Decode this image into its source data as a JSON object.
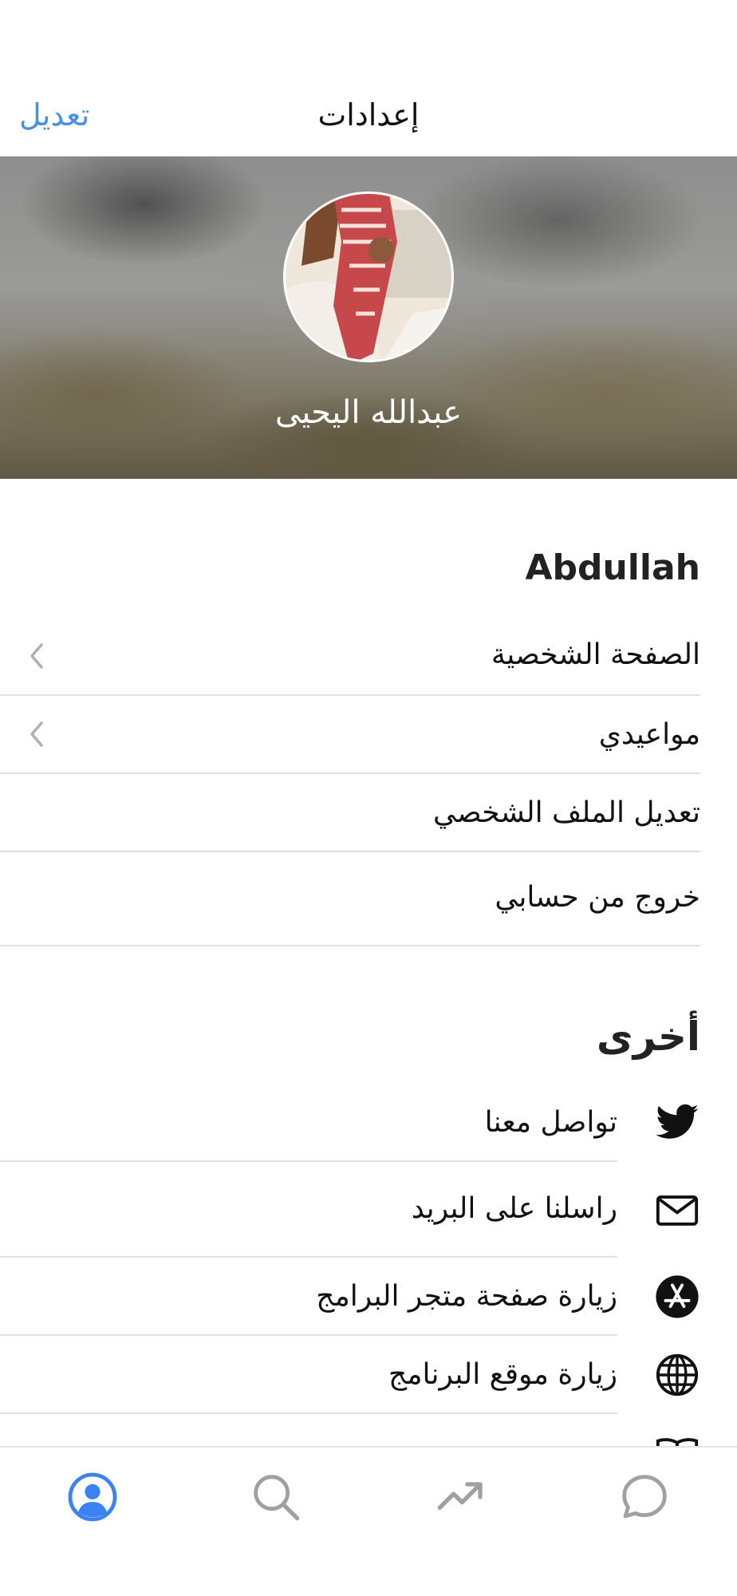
{
  "nav": {
    "title": "إعدادات",
    "edit_label": "تعديل"
  },
  "profile": {
    "name": "عبدالله اليحيى"
  },
  "account_section": {
    "title": "Abdullah",
    "items": [
      {
        "label": "الصفحة الشخصية",
        "icon": "chevron-left-icon"
      },
      {
        "label": "مواعيدي",
        "icon": "chevron-left-icon"
      },
      {
        "label": "تعديل الملف الشخصي"
      },
      {
        "label": "خروج من حسابي"
      }
    ]
  },
  "other_section": {
    "title": "أخرى",
    "items": [
      {
        "label": "تواصل معنا",
        "icon": "twitter-icon"
      },
      {
        "label": "راسلنا على البريد",
        "icon": "mail-icon"
      },
      {
        "label": "زيارة صفحة متجر البرامج",
        "icon": "app-store-icon"
      },
      {
        "label": "زيارة موقع البرنامج",
        "icon": "globe-icon"
      },
      {
        "label": "",
        "icon": "book-icon"
      }
    ]
  },
  "tabbar": {
    "tabs": [
      {
        "icon": "profile-icon",
        "active": true
      },
      {
        "icon": "search-icon",
        "active": false
      },
      {
        "icon": "trending-icon",
        "active": false
      },
      {
        "icon": "chat-icon",
        "active": false
      }
    ]
  },
  "colors": {
    "accent": "#4a90e2",
    "active_tab": "#3b82f6",
    "inactive_tab": "#a0a0a0"
  }
}
